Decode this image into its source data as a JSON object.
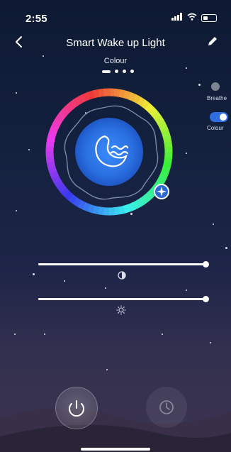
{
  "status_bar": {
    "time": "2:55",
    "signal_icon": "signal-icon",
    "wifi_icon": "wifi-icon",
    "battery_icon": "battery-icon"
  },
  "header": {
    "title": "Smart Wake up Light",
    "back_icon": "chevron-left-icon",
    "edit_icon": "pencil-icon"
  },
  "mode": {
    "label": "Colour",
    "page_count": 4,
    "active_page": 1
  },
  "side_toggles": [
    {
      "label": "Breathe",
      "on": false
    },
    {
      "label": "Colour",
      "on": true
    }
  ],
  "color_wheel": {
    "center_icon": "moon-waves-icon",
    "selector_icon": "sparkle-icon",
    "accent": "#2e73e6"
  },
  "sliders": [
    {
      "name": "saturation",
      "icon": "contrast-icon",
      "value_fraction": 1.0
    },
    {
      "name": "brightness",
      "icon": "sun-icon",
      "value_fraction": 1.0
    }
  ],
  "bottom": {
    "power_icon": "power-icon",
    "timer_icon": "clock-icon"
  }
}
